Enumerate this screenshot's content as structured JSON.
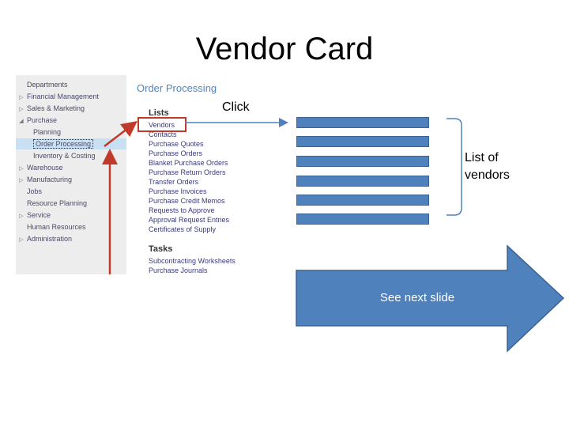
{
  "slide": {
    "title": "Vendor Card"
  },
  "navigation": {
    "items": [
      {
        "label": "Departments",
        "expander": ""
      },
      {
        "label": "Financial Management",
        "expander": "▷"
      },
      {
        "label": "Sales & Marketing",
        "expander": "▷"
      },
      {
        "label": "Purchase",
        "expander": "◢"
      },
      {
        "label": "Planning",
        "expander": ""
      },
      {
        "label": "Order Processing",
        "expander": ""
      },
      {
        "label": "Inventory & Costing",
        "expander": ""
      },
      {
        "label": "Warehouse",
        "expander": "▷"
      },
      {
        "label": "Manufacturing",
        "expander": "▷"
      },
      {
        "label": "Jobs",
        "expander": ""
      },
      {
        "label": "Resource Planning",
        "expander": ""
      },
      {
        "label": "Service",
        "expander": "▷"
      },
      {
        "label": "Human Resources",
        "expander": ""
      },
      {
        "label": "Administration",
        "expander": "▷"
      }
    ]
  },
  "order_processing": {
    "title": "Order Processing",
    "lists_heading": "Lists",
    "lists": [
      "Vendors",
      "Contacts",
      "Purchase Quotes",
      "Purchase Orders",
      "Blanket Purchase Orders",
      "Purchase Return Orders",
      "Transfer Orders",
      "Purchase Invoices",
      "Purchase Credit Memos",
      "Requests to Approve",
      "Approval Request Entries",
      "Certificates of Supply"
    ],
    "tasks_heading": "Tasks",
    "tasks": [
      "Subcontracting Worksheets",
      "Purchase Journals"
    ]
  },
  "annotations": {
    "click_label": "Click",
    "vendors_label_line1": "List of",
    "vendors_label_line2": "vendors",
    "next_label": "See next slide"
  },
  "colors": {
    "bar_fill": "#4f81bd",
    "highlight": "#c0392b",
    "accent": "#4f87c7"
  }
}
